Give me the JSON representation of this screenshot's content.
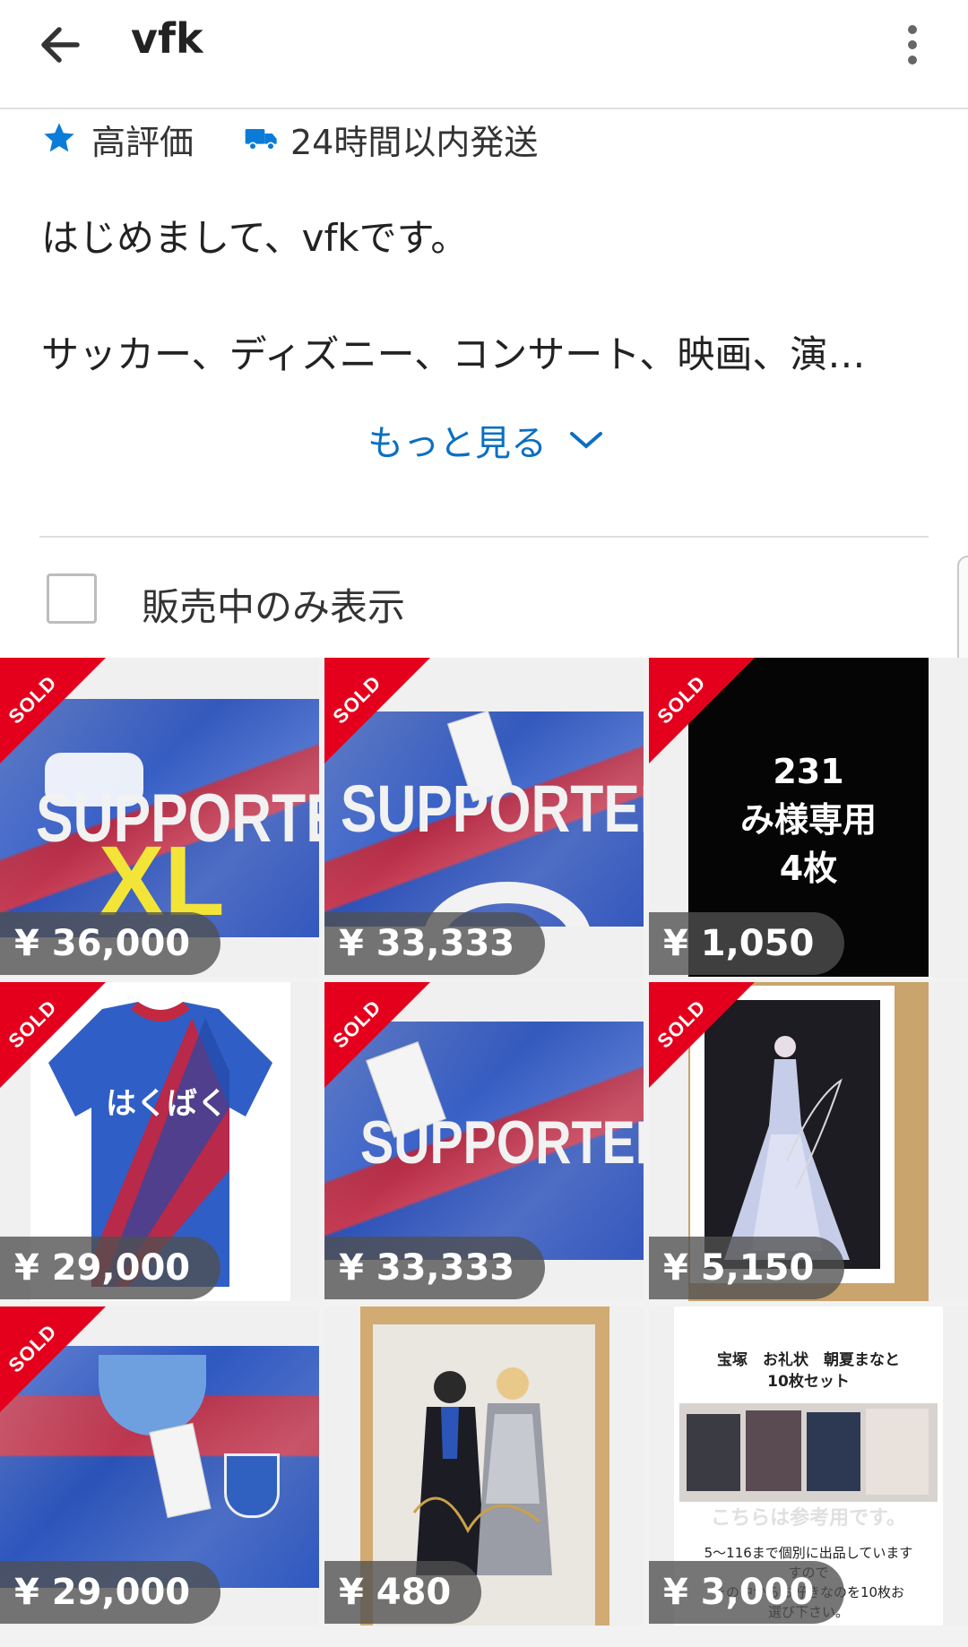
{
  "header": {
    "title": "vfk",
    "back_icon": "arrow-left-icon",
    "menu_icon": "more-vertical-icon"
  },
  "badges": [
    {
      "icon": "star-icon",
      "label": "高評価",
      "color": "#0a7cd8"
    },
    {
      "icon": "truck-icon",
      "label": "24時間以内発送",
      "color": "#0a7cd8"
    }
  ],
  "profile": {
    "intro": "はじめまして、vfkです。",
    "description": "サッカー、ディズニー、コンサート、映画、演…",
    "more_label": "もっと見る"
  },
  "filter": {
    "label": "販売中のみ表示",
    "checked": false
  },
  "colors": {
    "accent": "#0a6fc2",
    "sold_ribbon": "#e4001c",
    "price_pill": "#505050"
  },
  "items": [
    {
      "price": "¥ 36,000",
      "sold": true,
      "sold_label": "SOLD",
      "image_text": [
        "SUPPORTER",
        "XL"
      ]
    },
    {
      "price": "¥ 33,333",
      "sold": true,
      "sold_label": "SOLD",
      "image_text": [
        "SUPPORTER"
      ]
    },
    {
      "price": "¥ 1,050",
      "sold": true,
      "sold_label": "SOLD",
      "image_text": [
        "231",
        "み様専用",
        "4枚"
      ]
    },
    {
      "price": "¥ 29,000",
      "sold": true,
      "sold_label": "SOLD",
      "image_text": [
        "はくばく"
      ]
    },
    {
      "price": "¥ 33,333",
      "sold": true,
      "sold_label": "SOLD",
      "image_text": [
        "SUPPORTER"
      ]
    },
    {
      "price": "¥ 5,150",
      "sold": true,
      "sold_label": "SOLD",
      "image_text": []
    },
    {
      "price": "¥ 29,000",
      "sold": true,
      "sold_label": "SOLD",
      "image_text": []
    },
    {
      "price": "¥ 480",
      "sold": false,
      "sold_label": "",
      "image_text": []
    },
    {
      "price": "¥ 3,000",
      "sold": false,
      "sold_label": "",
      "image_text": [
        "宝塚　お礼状　朝夏まなと",
        "10枚セット",
        "こちらは参考用です。",
        "5〜116まで個別に出品しています",
        "すので",
        "その中からお好きなのを10枚お",
        "選び下さい。"
      ]
    }
  ]
}
